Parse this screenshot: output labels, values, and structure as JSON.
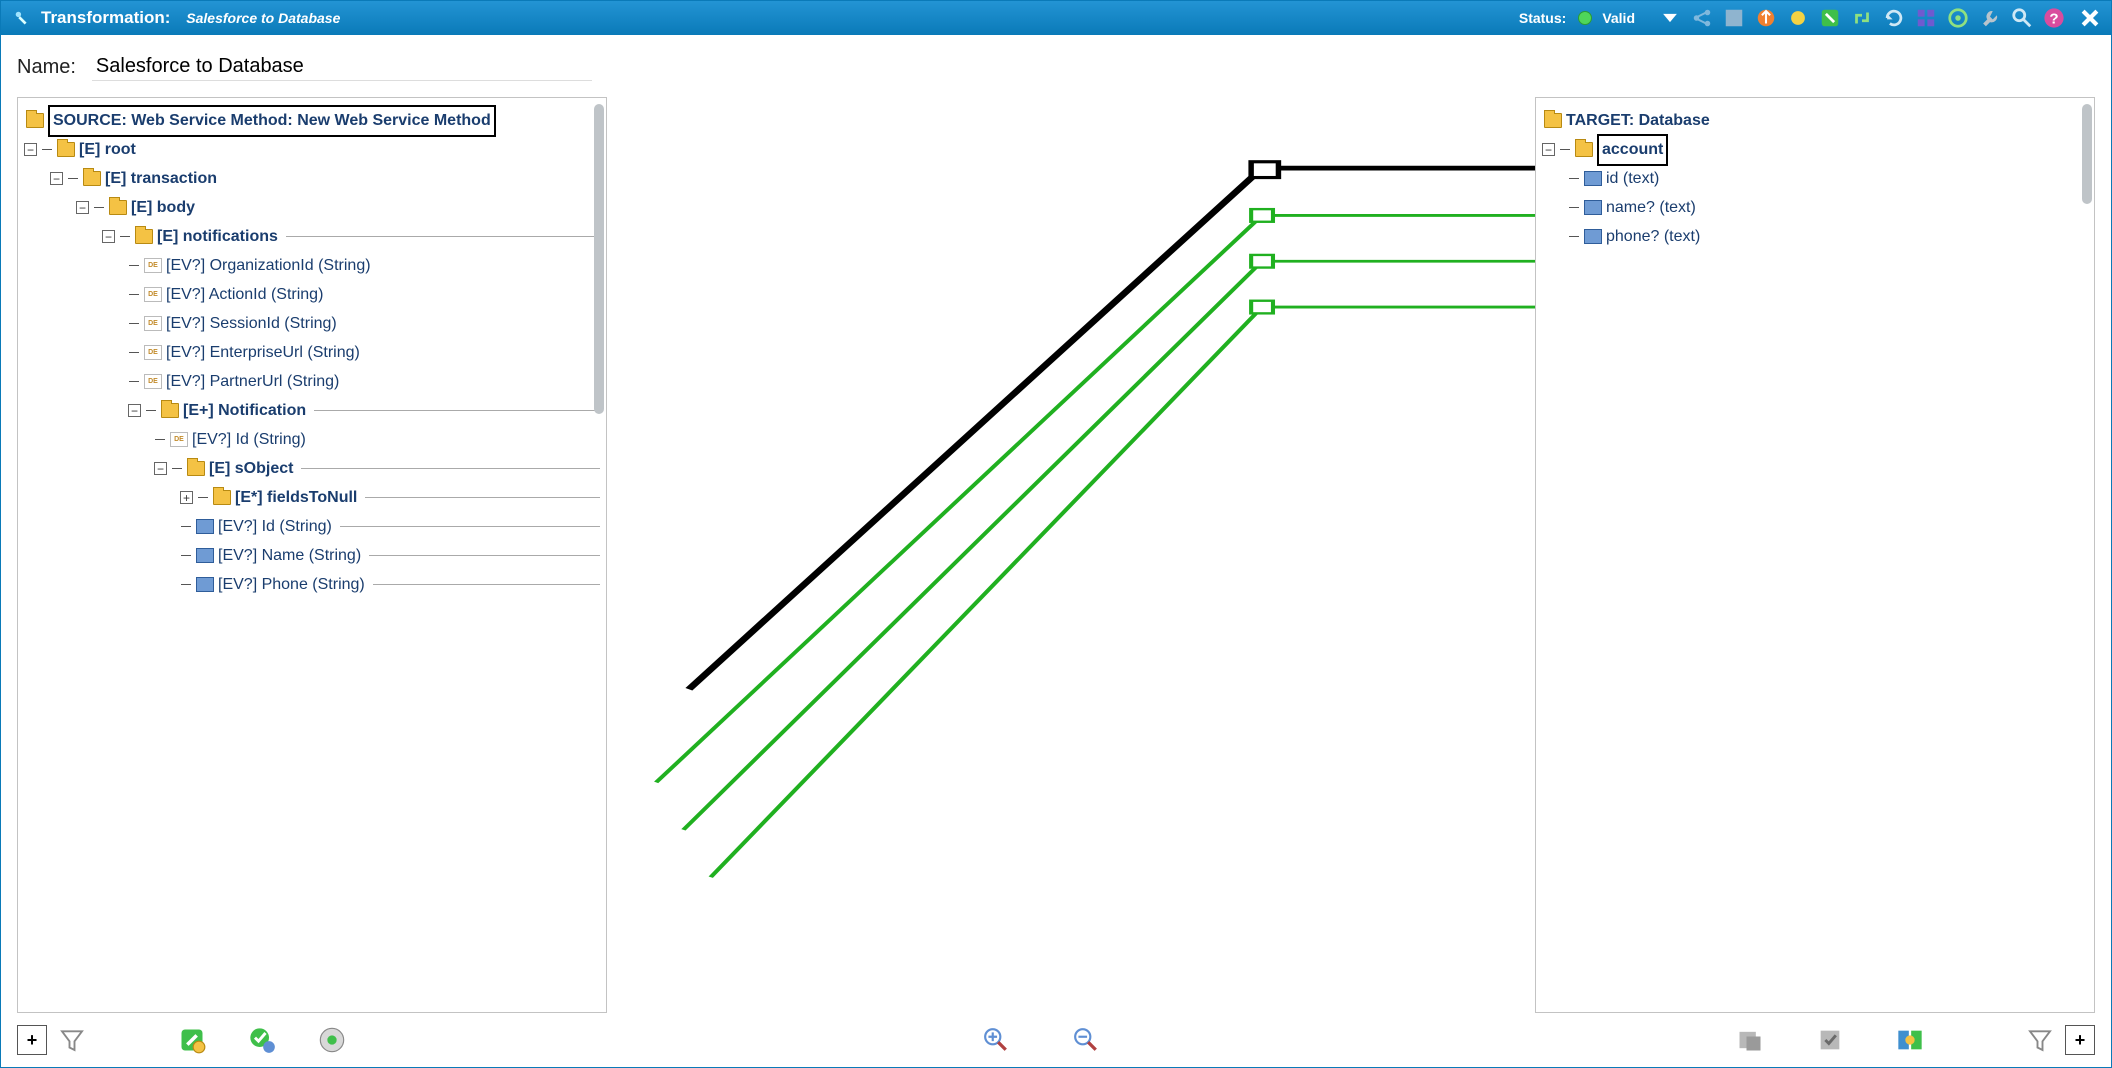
{
  "titlebar": {
    "label": "Transformation:",
    "name": "Salesforce to Database",
    "status_label": "Status:",
    "status_value": "Valid"
  },
  "name_field": {
    "label": "Name:",
    "value": "Salesforce to Database"
  },
  "source": {
    "header": "SOURCE: Web Service Method: New Web Service Method",
    "root": "[E] root",
    "transaction": "[E] transaction",
    "body": "[E] body",
    "notifications": "[E] notifications",
    "notif_children": [
      "[EV?] OrganizationId  (String)",
      "[EV?] ActionId  (String)",
      "[EV?] SessionId  (String)",
      "[EV?] EnterpriseUrl  (String)",
      "[EV?] PartnerUrl  (String)"
    ],
    "notification": "[E+] Notification",
    "notification_id": "[EV?] Id  (String)",
    "sobject": "[E] sObject",
    "fields_to_null": "[E*] fieldsToNull",
    "sobject_fields": [
      "[EV?] Id  (String)",
      "[EV?] Name  (String)",
      "[EV?] Phone  (String)"
    ]
  },
  "target": {
    "header": "TARGET: Database",
    "account": "account",
    "fields": [
      "id (text)",
      "name? (text)",
      "phone? (text)"
    ]
  },
  "mappings": [
    {
      "source": "sObject",
      "target": "account",
      "color": "#000",
      "width": 3
    },
    {
      "source": "Id",
      "target": "id",
      "color": "#20b020",
      "width": 2
    },
    {
      "source": "Name",
      "target": "name",
      "color": "#20b020",
      "width": 2
    },
    {
      "source": "Phone",
      "target": "phone",
      "color": "#20b020",
      "width": 2
    }
  ]
}
